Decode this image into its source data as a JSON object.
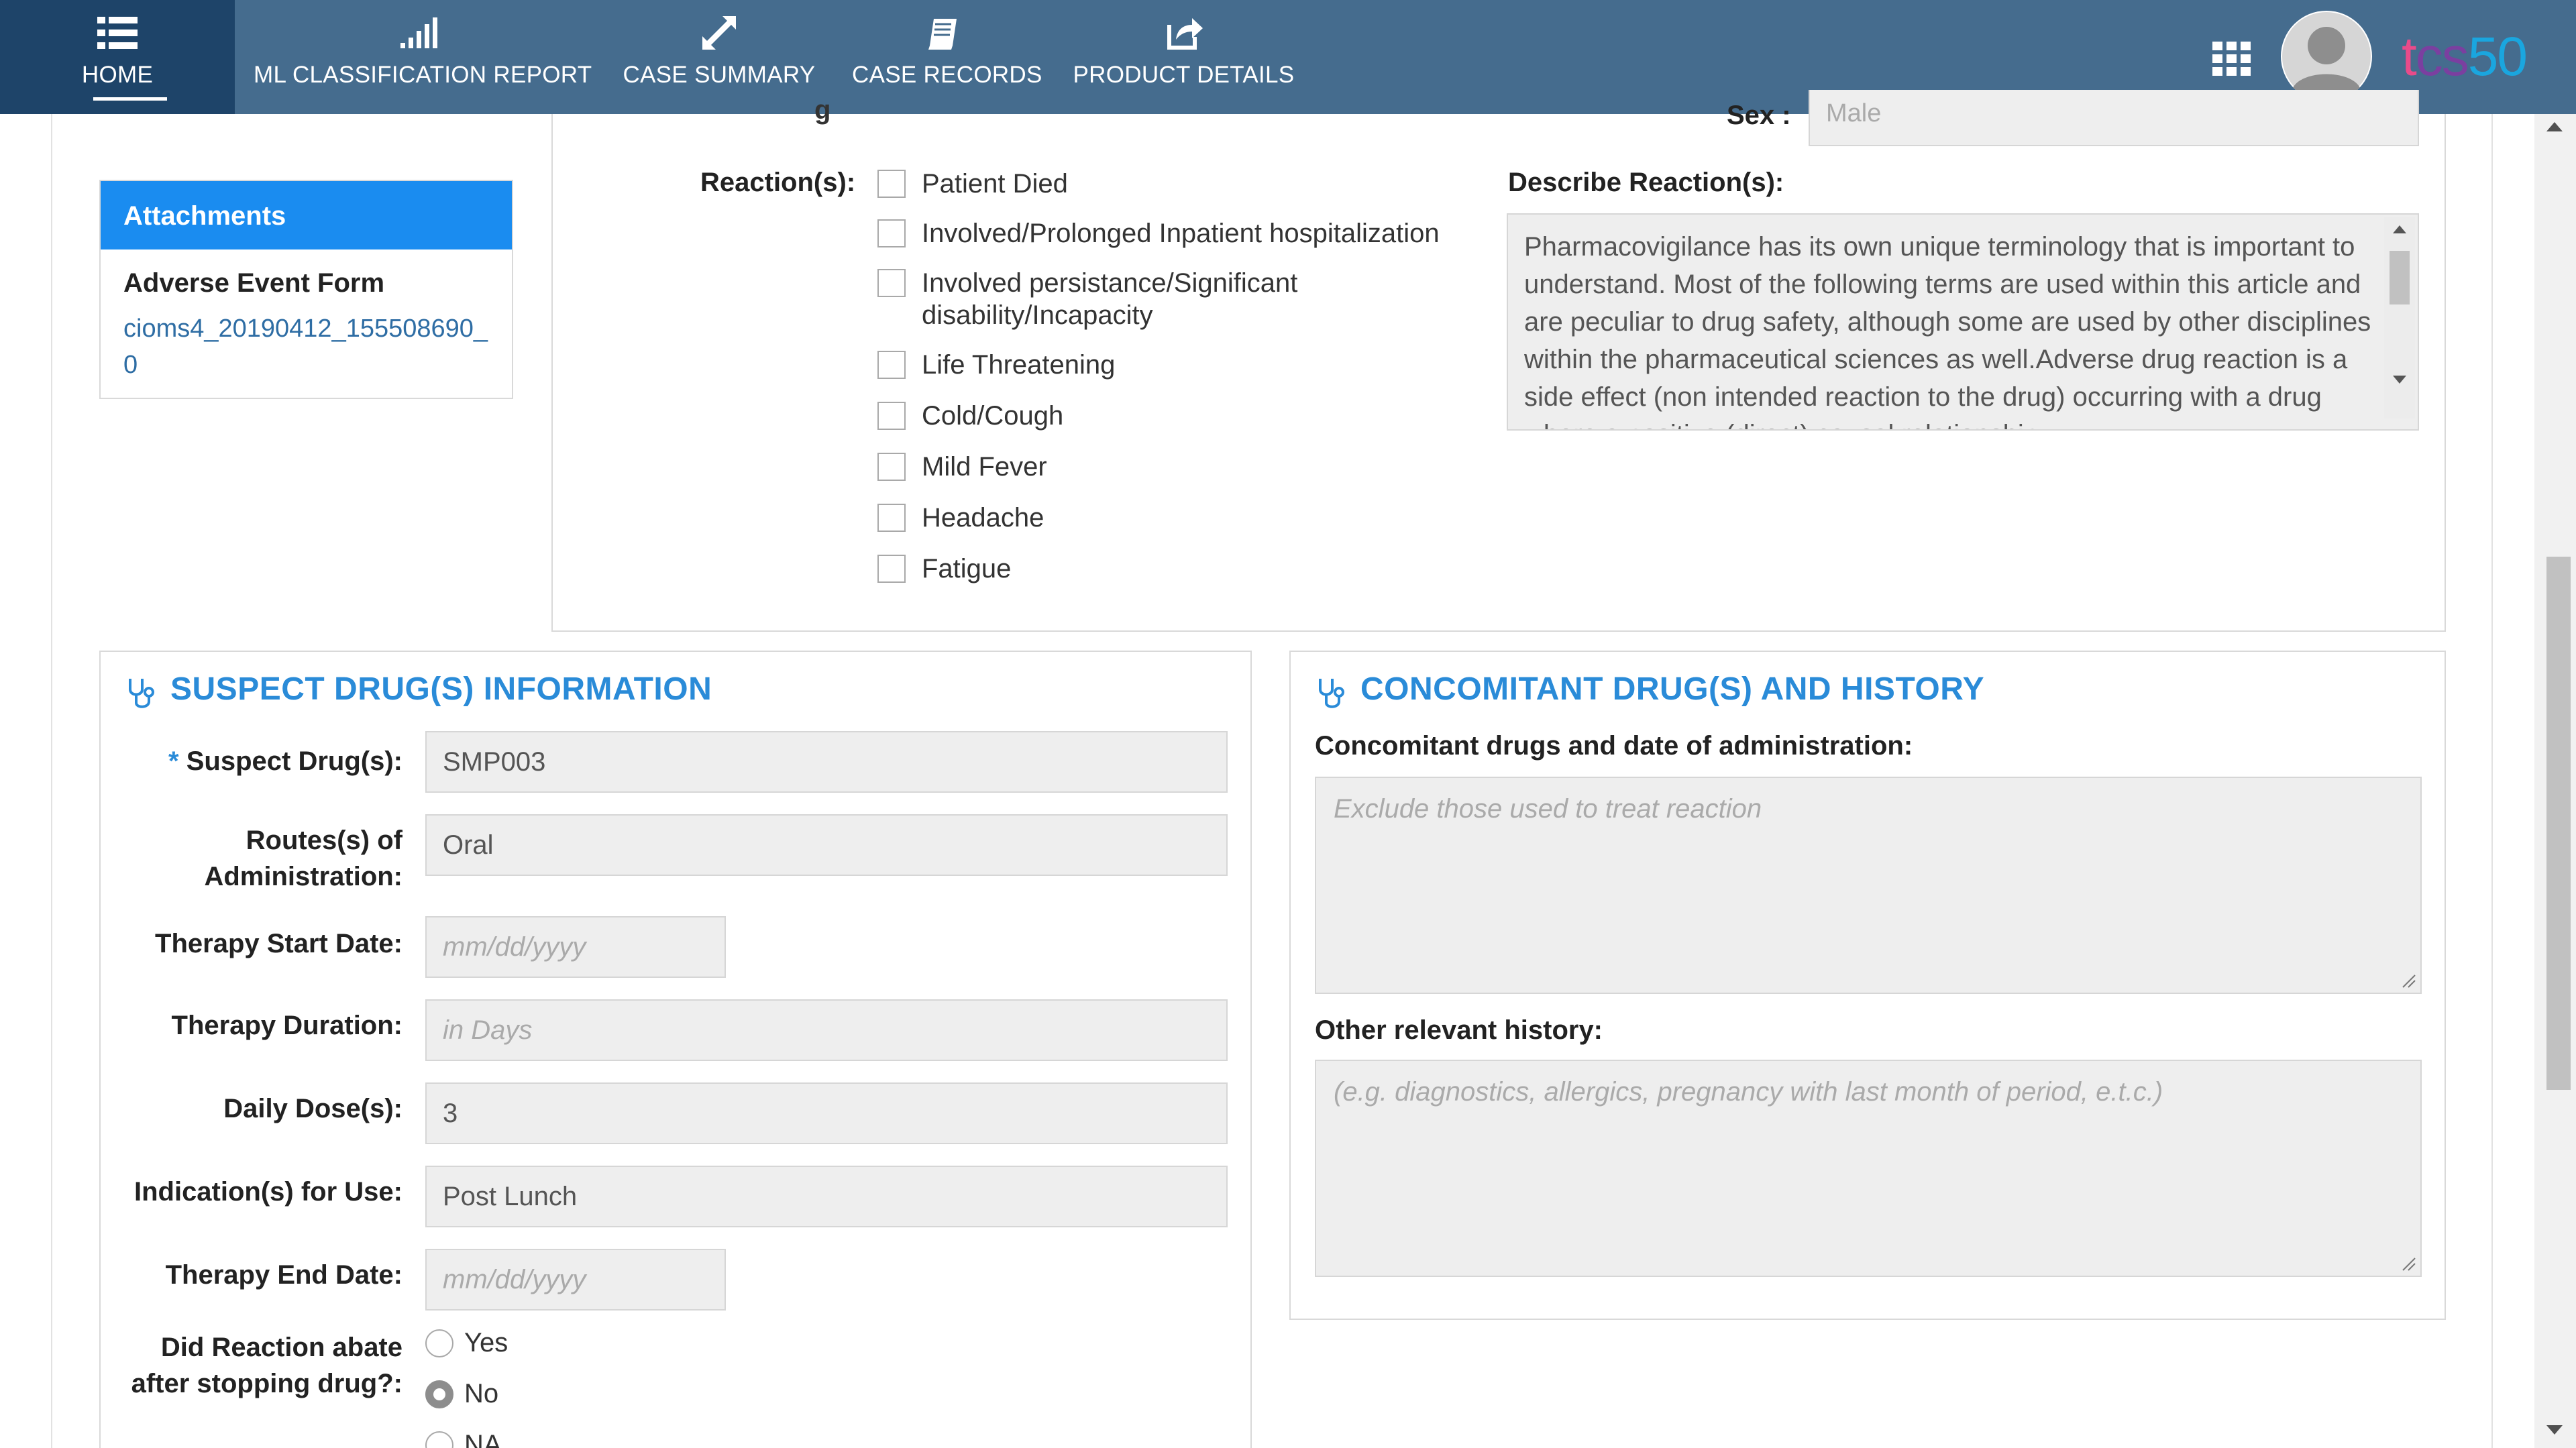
{
  "nav": {
    "items": [
      {
        "label": "HOME",
        "icon": "list-icon"
      },
      {
        "label": "ML CLASSIFICATION REPORT",
        "icon": "signal-bars-icon"
      },
      {
        "label": "CASE SUMMARY",
        "icon": "expand-arrows-icon"
      },
      {
        "label": "CASE RECORDS",
        "icon": "book-icon"
      },
      {
        "label": "PRODUCT DETAILS",
        "icon": "share-icon"
      }
    ],
    "logo": {
      "part1": "t",
      "part2": "cs",
      "part3": "50"
    }
  },
  "attachments": {
    "header": "Attachments",
    "form_title": "Adverse Event Form",
    "file_link": "cioms4_20190412_155508690_0"
  },
  "patient": {
    "sex_label": "Sex :",
    "sex_value": "Male",
    "name_stub": "g"
  },
  "reactions": {
    "label": "Reaction(s):",
    "options": [
      "Patient Died",
      "Involved/Prolonged Inpatient hospitalization",
      "Involved persistance/Significant disability/Incapacity",
      "Life Threatening",
      "Cold/Cough",
      "Mild Fever",
      "Headache",
      "Fatigue"
    ],
    "describe_label": "Describe Reaction(s):",
    "describe_text": "Pharmacovigilance has its own unique terminology that is important to understand. Most of the following terms are used within this article and are peculiar to drug safety, although some are used by other disciplines within the pharmaceutical sciences as well.Adverse drug reaction is a side effect (non intended reaction to the drug) occurring with a drug where a positive (direct) causal relationship"
  },
  "suspect": {
    "title": "SUSPECT DRUG(S) INFORMATION",
    "required_mark": "*",
    "drug_label": "Suspect Drug(s):",
    "drug_value": "SMP003",
    "route_label_1": "Routes(s) of",
    "route_label_2": "Administration:",
    "route_value": "Oral",
    "start_label": "Therapy Start Date:",
    "start_placeholder": "mm/dd/yyyy",
    "duration_label": "Therapy Duration:",
    "duration_placeholder": "in Days",
    "dose_label": "Daily Dose(s):",
    "dose_value": "3",
    "indication_label": "Indication(s) for Use:",
    "indication_value": "Post Lunch",
    "end_label": "Therapy End Date:",
    "end_placeholder": "mm/dd/yyyy",
    "abate_label_1": "Did Reaction abate",
    "abate_label_2": "after stopping drug?:",
    "abate_options": [
      "Yes",
      "No",
      "NA"
    ],
    "abate_selected": "No"
  },
  "concomitant": {
    "title": "CONCOMITANT DRUG(S) AND HISTORY",
    "drugs_label": "Concomitant drugs and date of administration:",
    "drugs_placeholder": "Exclude those used to treat reaction",
    "history_label": "Other relevant history:",
    "history_placeholder": "(e.g. diagnostics, allergics, pregnancy with last month of period, e.t.c.)"
  },
  "colors": {
    "nav_bg": "#456c8e",
    "nav_active": "#1e4469",
    "attachments_header": "#1a8cf0",
    "section_title": "#2a8bd8"
  }
}
